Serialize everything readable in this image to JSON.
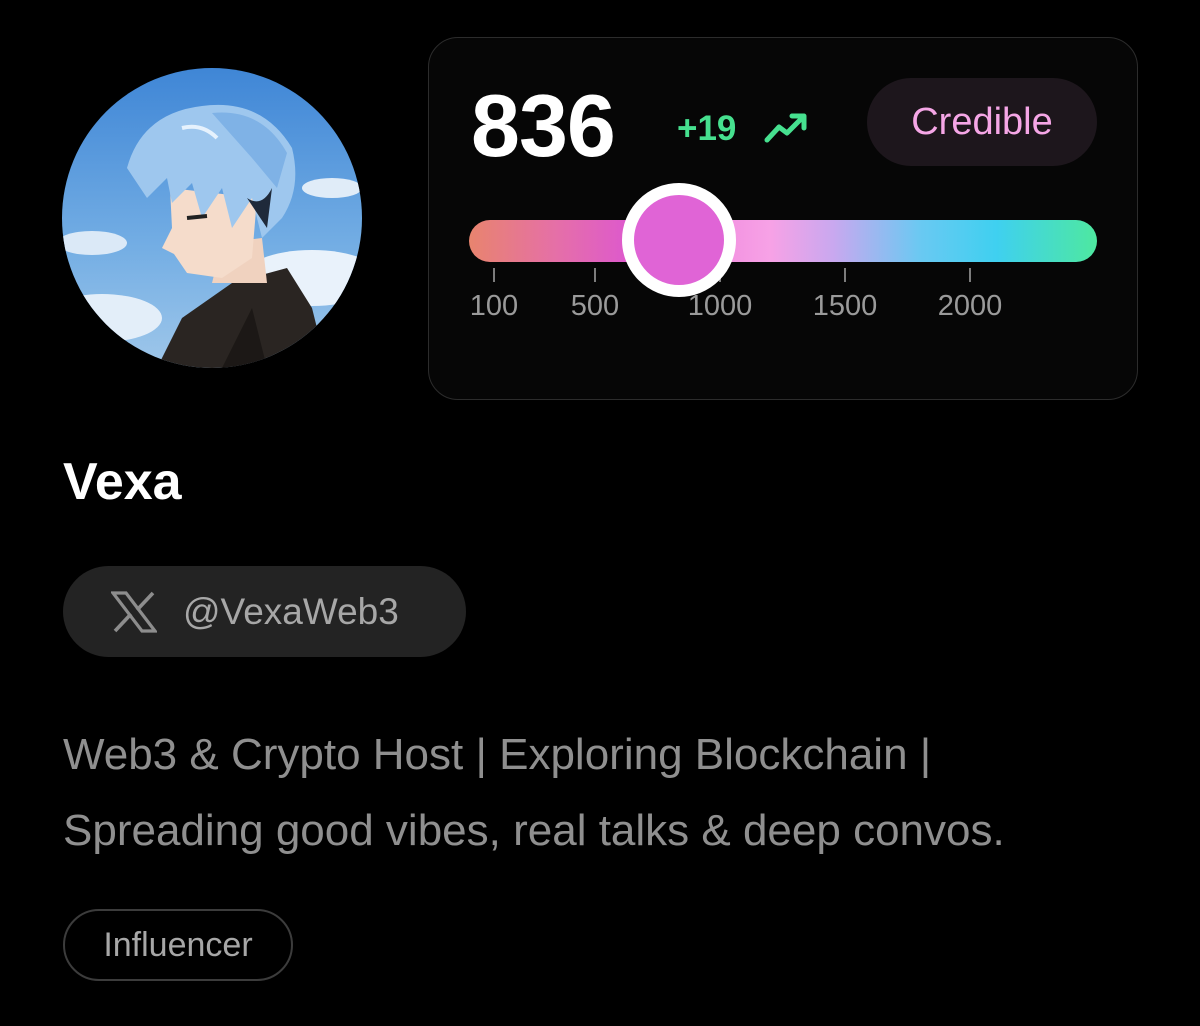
{
  "profile": {
    "name": "Vexa",
    "handle": "@VexaWeb3",
    "bio_lines": [
      "Web3 & Crypto Host | Exploring Blockchain |",
      "Spreading good vibes, real talks & deep convos."
    ],
    "tag": "Influencer",
    "avatar_icon": "anime-avatar-icon"
  },
  "score": {
    "value": "836",
    "value_number": 836,
    "delta": "+19",
    "trend_icon": "trending-up-icon",
    "badge": "Credible",
    "scale_ticks": [
      {
        "label": "100",
        "value": 100
      },
      {
        "label": "500",
        "value": 500
      },
      {
        "label": "1000",
        "value": 1000
      },
      {
        "label": "1500",
        "value": 1500
      },
      {
        "label": "2000",
        "value": 2000
      }
    ]
  },
  "colors": {
    "background": "#000000",
    "delta_green": "#46e08f",
    "badge_text": "#f5a6e6",
    "thumb": "#e064d6"
  }
}
